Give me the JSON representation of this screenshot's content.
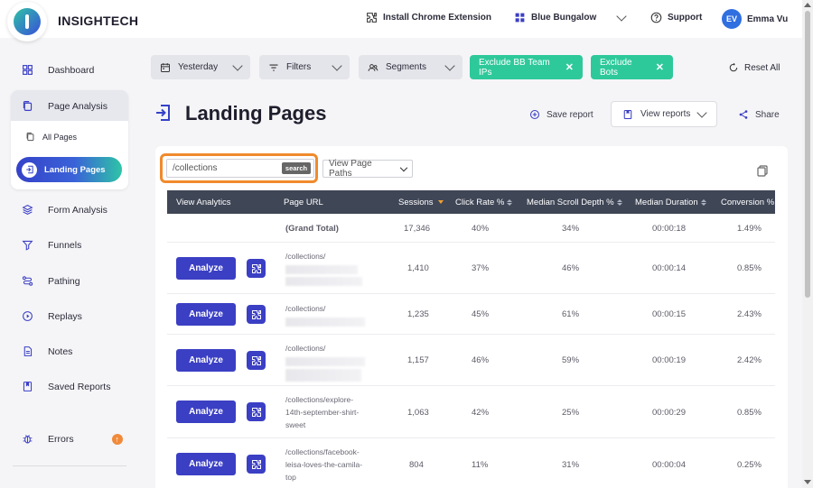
{
  "header": {
    "brand": "INSIGHTECH",
    "install_label": "Install Chrome Extension",
    "workspace_label": "Blue Bungalow",
    "support_label": "Support",
    "user_initials": "EV",
    "user_name": "Emma Vu"
  },
  "sidebar": {
    "dashboard": "Dashboard",
    "page_analysis": "Page Analysis",
    "all_pages": "All Pages",
    "landing_pages": "Landing Pages",
    "form_analysis": "Form Analysis",
    "funnels": "Funnels",
    "pathing": "Pathing",
    "replays": "Replays",
    "notes": "Notes",
    "saved_reports": "Saved Reports",
    "errors": "Errors",
    "errors_badge": "↑"
  },
  "toolbar": {
    "date_label": "Yesterday",
    "filters_label": "Filters",
    "segments_label": "Segments",
    "exclude_team": "Exclude BB Team IPs",
    "exclude_bots": "Exclude Bots",
    "close_glyph": "✕",
    "reset_label": "Reset All"
  },
  "page": {
    "title": "Landing Pages",
    "save_report": "Save report",
    "view_reports": "View reports",
    "share": "Share"
  },
  "search": {
    "value": "/collections",
    "button_label": "search"
  },
  "view_select": {
    "selected": "View Page Paths"
  },
  "table": {
    "headers": {
      "view_analytics": "View Analytics",
      "page_url": "Page URL",
      "sessions": "Sessions",
      "click_rate": "Click Rate %",
      "scroll_depth": "Median Scroll Depth %",
      "duration": "Median Duration",
      "conversion": "Conversion %"
    },
    "analyze_label": "Analyze",
    "grand_total": {
      "label": "(Grand Total)",
      "sessions": "17,346",
      "click_rate": "40%",
      "scroll_depth": "34%",
      "duration": "00:00:18",
      "conversion": "1.49%"
    },
    "rows": [
      {
        "url": "/collections/",
        "sessions": "1,410",
        "click_rate": "37%",
        "scroll_depth": "46%",
        "duration": "00:00:14",
        "conversion": "0.85%"
      },
      {
        "url": "/collections/",
        "sessions": "1,235",
        "click_rate": "45%",
        "scroll_depth": "61%",
        "duration": "00:00:15",
        "conversion": "2.43%"
      },
      {
        "url": "/collections/",
        "sessions": "1,157",
        "click_rate": "46%",
        "scroll_depth": "59%",
        "duration": "00:00:19",
        "conversion": "2.42%"
      },
      {
        "url": "/collections/explore-14th-september-shirt-sweet",
        "sessions": "1,063",
        "click_rate": "42%",
        "scroll_depth": "25%",
        "duration": "00:00:29",
        "conversion": "0.85%"
      },
      {
        "url": "/collections/facebook-leisa-loves-the-camila-top",
        "sessions": "804",
        "click_rate": "11%",
        "scroll_depth": "31%",
        "duration": "00:00:04",
        "conversion": "0.25%"
      }
    ]
  },
  "colors": {
    "accent": "#3b3fc4",
    "green": "#2ec99b",
    "highlight": "#f08a2c",
    "table_header": "#3f4656"
  }
}
